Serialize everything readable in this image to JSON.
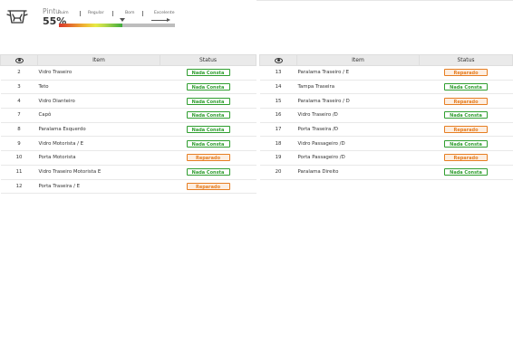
{
  "header": {
    "title": "Pintu",
    "score": "55%",
    "icon": "car-icon",
    "scale": {
      "labels": [
        "Ruim",
        "Regular",
        "Bom",
        "Excelente"
      ],
      "level_fraction": 0.55
    }
  },
  "columns": {
    "icon": "eye-icon",
    "item": "Item",
    "status": "Status"
  },
  "colors": {
    "ok": "#2f9e2f",
    "repaired": "#e67e22",
    "header_bg": "#eaeaea"
  },
  "left_rows": [
    {
      "num": "2",
      "item": "Vidro Traseiro",
      "status": "Nada Consta",
      "kind": "ok"
    },
    {
      "num": "3",
      "item": "Teto",
      "status": "Nada Consta",
      "kind": "ok"
    },
    {
      "num": "4",
      "item": "Vidro Dianteiro",
      "status": "Nada Consta",
      "kind": "ok"
    },
    {
      "num": "7",
      "item": "Capô",
      "status": "Nada Consta",
      "kind": "ok"
    },
    {
      "num": "8",
      "item": "Paralama Esquerdo",
      "status": "Nada Consta",
      "kind": "ok"
    },
    {
      "num": "9",
      "item": "Vidro Motorista / E",
      "status": "Nada Consta",
      "kind": "ok"
    },
    {
      "num": "10",
      "item": "Porta Motorista",
      "status": "Reparado",
      "kind": "rep"
    },
    {
      "num": "11",
      "item": "Vidro Traseiro Motorista E",
      "status": "Nada Consta",
      "kind": "ok"
    },
    {
      "num": "12",
      "item": "Porta Traseira / E",
      "status": "Reparado",
      "kind": "rep"
    }
  ],
  "right_rows": [
    {
      "num": "13",
      "item": "Paralama Traseiro / E",
      "status": "Reparado",
      "kind": "rep"
    },
    {
      "num": "14",
      "item": "Tampa Traseira",
      "status": "Nada Consta",
      "kind": "ok"
    },
    {
      "num": "15",
      "item": "Paralama Traseiro / D",
      "status": "Reparado",
      "kind": "rep"
    },
    {
      "num": "16",
      "item": "Vidro Traseiro /D",
      "status": "Nada Consta",
      "kind": "ok"
    },
    {
      "num": "17",
      "item": "Porta Traseira /D",
      "status": "Reparado",
      "kind": "rep"
    },
    {
      "num": "18",
      "item": "Vidro Passageiro /D",
      "status": "Nada Consta",
      "kind": "ok"
    },
    {
      "num": "19",
      "item": "Porta Passageiro /D",
      "status": "Reparado",
      "kind": "rep"
    },
    {
      "num": "20",
      "item": "Paralama Direito",
      "status": "Nada Consta",
      "kind": "ok"
    }
  ]
}
